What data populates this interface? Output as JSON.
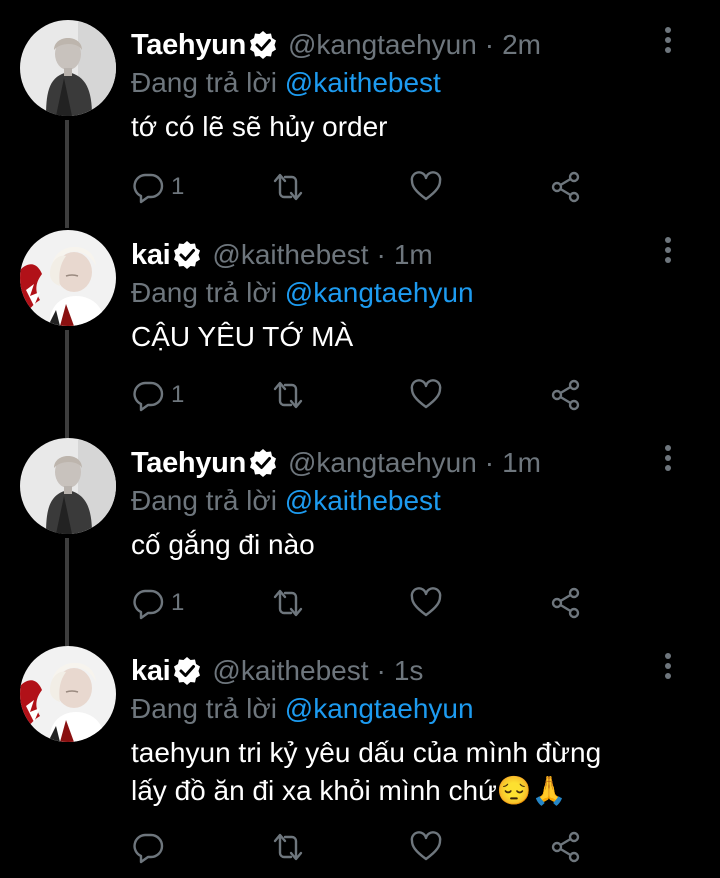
{
  "colors": {
    "background": "#000000",
    "text": "#ffffff",
    "secondary": "#6e767d",
    "link": "#1d9bf0",
    "verified": "#ffffff",
    "thread_line": "#3d3d3d"
  },
  "reply_prefix": "Đang trả lời",
  "tweets": [
    {
      "name": "Taehyun",
      "handle": "@kangtaehyun",
      "separator": "·",
      "time": "2m",
      "reply_to": "@kaithebest",
      "lines": [
        "tớ có lẽ sẽ hủy order"
      ],
      "reply_count": "1",
      "avatar": "avatar-taehyun",
      "icons": [
        "comment-icon",
        "retweet-icon",
        "like-icon",
        "share-icon",
        "more-icon"
      ]
    },
    {
      "name": "kai",
      "handle": "@kaithebest",
      "separator": "·",
      "time": "1m",
      "reply_to": "@kangtaehyun",
      "lines": [
        "CẬU YÊU TỚ MÀ"
      ],
      "reply_count": "1",
      "avatar": "avatar-kai",
      "icons": [
        "comment-icon",
        "retweet-icon",
        "like-icon",
        "share-icon",
        "more-icon"
      ]
    },
    {
      "name": "Taehyun",
      "handle": "@kangtaehyun",
      "separator": "·",
      "time": "1m",
      "reply_to": "@kaithebest",
      "lines": [
        "cố gắng đi nào"
      ],
      "reply_count": "1",
      "avatar": "avatar-taehyun",
      "icons": [
        "comment-icon",
        "retweet-icon",
        "like-icon",
        "share-icon",
        "more-icon"
      ]
    },
    {
      "name": "kai",
      "handle": "@kaithebest",
      "separator": "·",
      "time": "1s",
      "reply_to": "@kangtaehyun",
      "lines": [
        "taehyun tri kỷ yêu dấu của mình đừng",
        "lấy đồ ăn đi xa khỏi mình chứ😔🙏"
      ],
      "reply_count": "",
      "avatar": "avatar-kai",
      "icons": [
        "comment-icon",
        "retweet-icon",
        "like-icon",
        "share-icon",
        "more-icon"
      ]
    }
  ]
}
